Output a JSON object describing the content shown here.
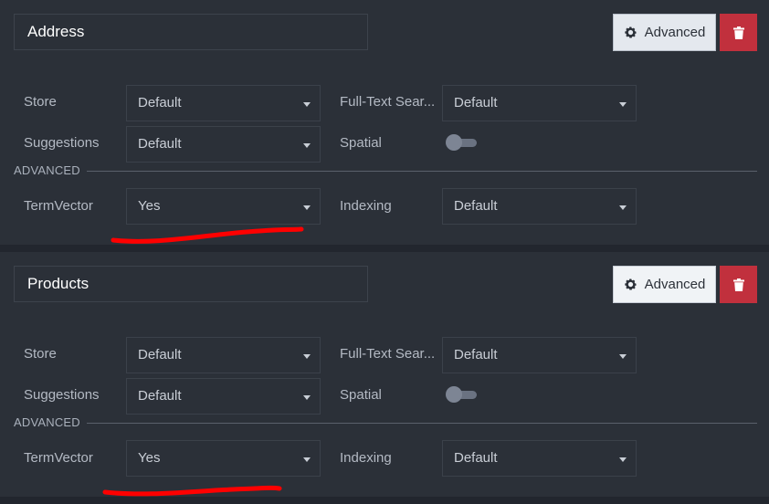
{
  "panels": [
    {
      "field_name": "Address",
      "advanced_button": "Advanced",
      "store": {
        "label": "Store",
        "value": "Default"
      },
      "fulltext": {
        "label": "Full-Text Sear...",
        "value": "Default"
      },
      "suggestions": {
        "label": "Suggestions",
        "value": "Default"
      },
      "spatial": {
        "label": "Spatial",
        "on": false
      },
      "advanced_section": "ADVANCED",
      "termvector": {
        "label": "TermVector",
        "value": "Yes"
      },
      "indexing": {
        "label": "Indexing",
        "value": "Default"
      }
    },
    {
      "field_name": "Products",
      "advanced_button": "Advanced",
      "store": {
        "label": "Store",
        "value": "Default"
      },
      "fulltext": {
        "label": "Full-Text Sear...",
        "value": "Default"
      },
      "suggestions": {
        "label": "Suggestions",
        "value": "Default"
      },
      "spatial": {
        "label": "Spatial",
        "on": false
      },
      "advanced_section": "ADVANCED",
      "termvector": {
        "label": "TermVector",
        "value": "Yes"
      },
      "indexing": {
        "label": "Indexing",
        "value": "Default"
      }
    }
  ],
  "colors": {
    "annotation": "#ff0000",
    "delete": "#c1303d",
    "panel": "#2b3038"
  }
}
